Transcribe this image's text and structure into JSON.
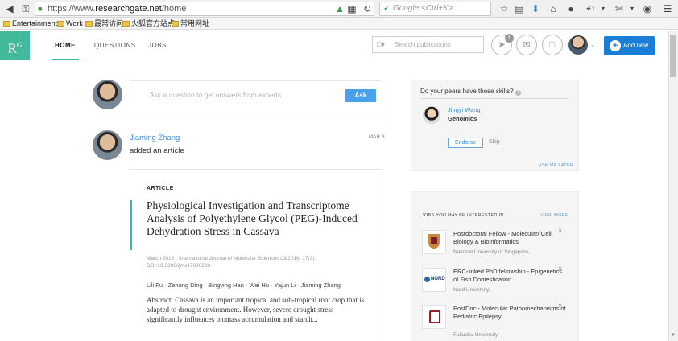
{
  "browser": {
    "url_prefix": "https://www.",
    "url_domain": "researchgate.net",
    "url_path": "/home",
    "search_placeholder": "Google <Ctrl+K>",
    "bookmarks": [
      "Entertainment",
      "Work",
      "最常访问",
      "火狐官方站点",
      "常用网址"
    ]
  },
  "rg_header": {
    "logo": "R",
    "logo_sup": "G",
    "nav": [
      "HOME",
      "QUESTIONS",
      "JOBS"
    ],
    "search_placeholder": "Search publications",
    "notification_count": "1",
    "add_new_label": "Add new"
  },
  "ask": {
    "placeholder": "Ask a question to get answers from experts",
    "button_label": "Ask"
  },
  "post": {
    "author": "Jiaming Zhang",
    "action": "added an article",
    "date": "MAR 3",
    "article": {
      "type": "ARTICLE",
      "title": "Physiological Investigation and Transcriptome Analysis of Polyethylene Glycol (PEG)-Induced Dehydration Stress in Cassava",
      "meta_line1": "March 2016 · International Journal of Molecular Sciences 03/2016; 17(3).",
      "meta_line2": "DOI:10.3390/ijms17030283",
      "authors": "Lili Fu · Zehong Ding · Bingying Han · Wei Hu · Yajun Li · Jiaming Zhang",
      "abstract": "Abstract: Cassava is an important tropical and sub-tropical root crop that is adapted to drought environment. However, severe drought stress significantly influences biomass accumulation and starch..."
    }
  },
  "skills": {
    "question": "Do your peers have these skills?",
    "info_icon": "i",
    "peer_name": "Jingyi Wang",
    "skill": "Genomics",
    "endorse_label": "Endorse",
    "skip_label": "Skip",
    "ask_later": "ASK ME LATER"
  },
  "jobs": {
    "heading": "JOBS YOU MAY BE INTERESTED IN",
    "view_more": "VIEW MORE",
    "items": [
      {
        "title": "Postdoctoral Fellow - Molecular/ Cell Biology & Bioinformatics",
        "org": "National University of Singapore,"
      },
      {
        "title": "ERC-linked PhD fellowship - Epigenetics of Fish Domestication",
        "org": "Nord University,",
        "logo_text": "NORD"
      },
      {
        "title": "PostDoc - Molecular Pathomechanisms of Pediatric Epilepsy",
        "org": "Fukuoka University,"
      }
    ],
    "close_glyph": "×"
  }
}
